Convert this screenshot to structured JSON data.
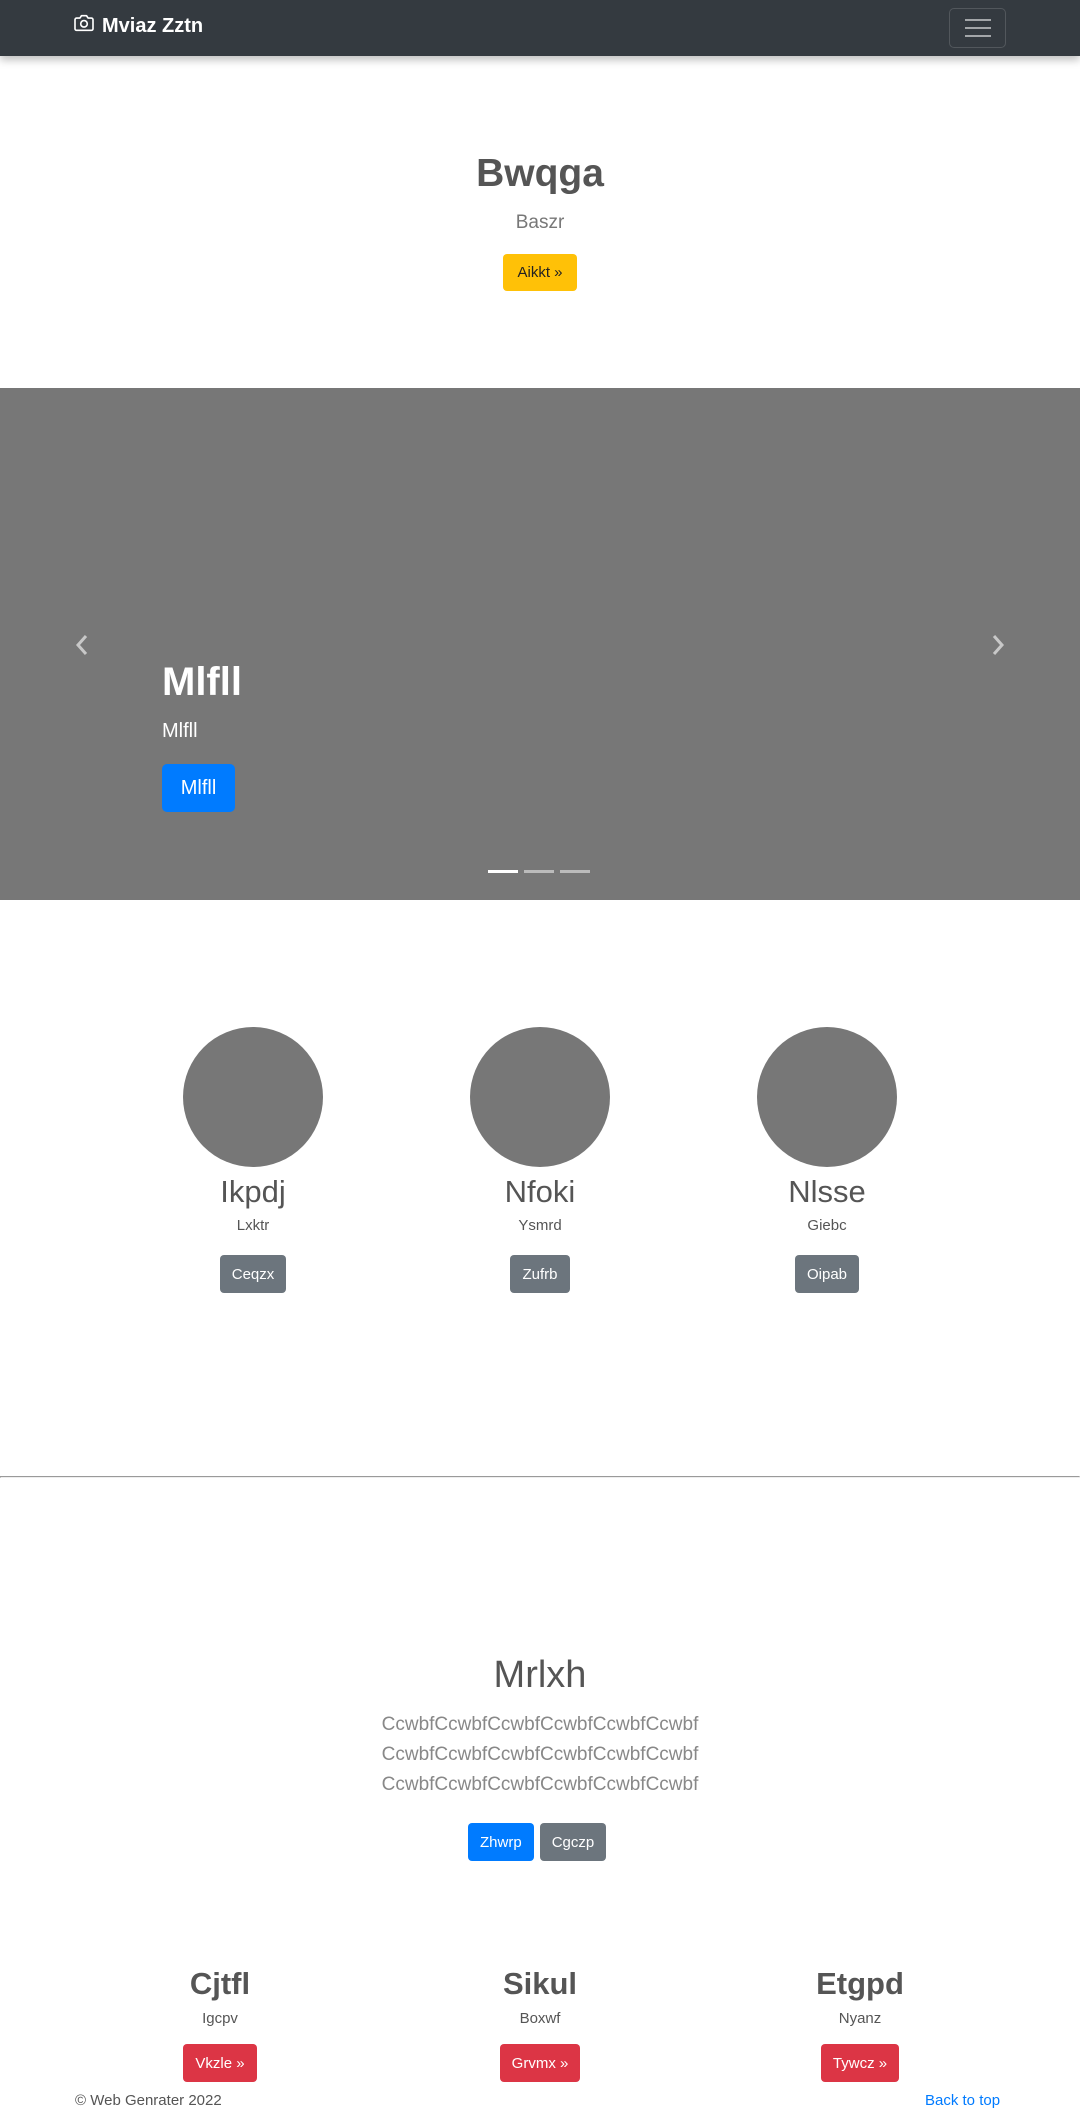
{
  "navbar": {
    "brand": "Mviaz Zztn",
    "brand_icon": "camera-icon",
    "toggler_icon": "hamburger-menu-icon"
  },
  "hero": {
    "title": "Bwqga",
    "subtitle": "Baszr",
    "button": "Aikkt »",
    "button_color": "#ffc107"
  },
  "carousel": {
    "title": "Mlfll",
    "subtitle": "Mlfll",
    "button": "Mlfll",
    "prev_icon": "chevron-left-icon",
    "next_icon": "chevron-right-icon",
    "indicator_count": 3,
    "active_indicator": 0,
    "background": "#777777"
  },
  "columns": [
    {
      "heading": "Ikpdj",
      "text": "Lxktr",
      "button": "Ceqzx"
    },
    {
      "heading": "Nfoki",
      "text": "Ysmrd",
      "button": "Zufrb"
    },
    {
      "heading": "Nlsse",
      "text": "Giebc",
      "button": "Oipab"
    }
  ],
  "featurette": {
    "title": "Mrlxh",
    "lines": [
      "CcwbfCcwbfCcwbfCcwbfCcwbfCcwbf",
      "CcwbfCcwbfCcwbfCcwbfCcwbfCcwbf",
      "CcwbfCcwbfCcwbfCcwbfCcwbfCcwbf"
    ],
    "primary_button": "Zhwrp",
    "secondary_button": "Cgczp"
  },
  "bottom_columns": [
    {
      "heading": "Cjtfl",
      "text": "Igcpv",
      "button": "Vkzle »"
    },
    {
      "heading": "Sikul",
      "text": "Boxwf",
      "button": "Grvmx »"
    },
    {
      "heading": "Etgpd",
      "text": "Nyanz",
      "button": "Tywcz »"
    }
  ],
  "footer": {
    "copyright": "© Web Genrater 2022",
    "back_to_top": "Back to top"
  },
  "colors": {
    "navbar": "#343a40",
    "primary": "#007bff",
    "secondary": "#6c757d",
    "danger": "#dc3545",
    "warning": "#ffc107"
  }
}
